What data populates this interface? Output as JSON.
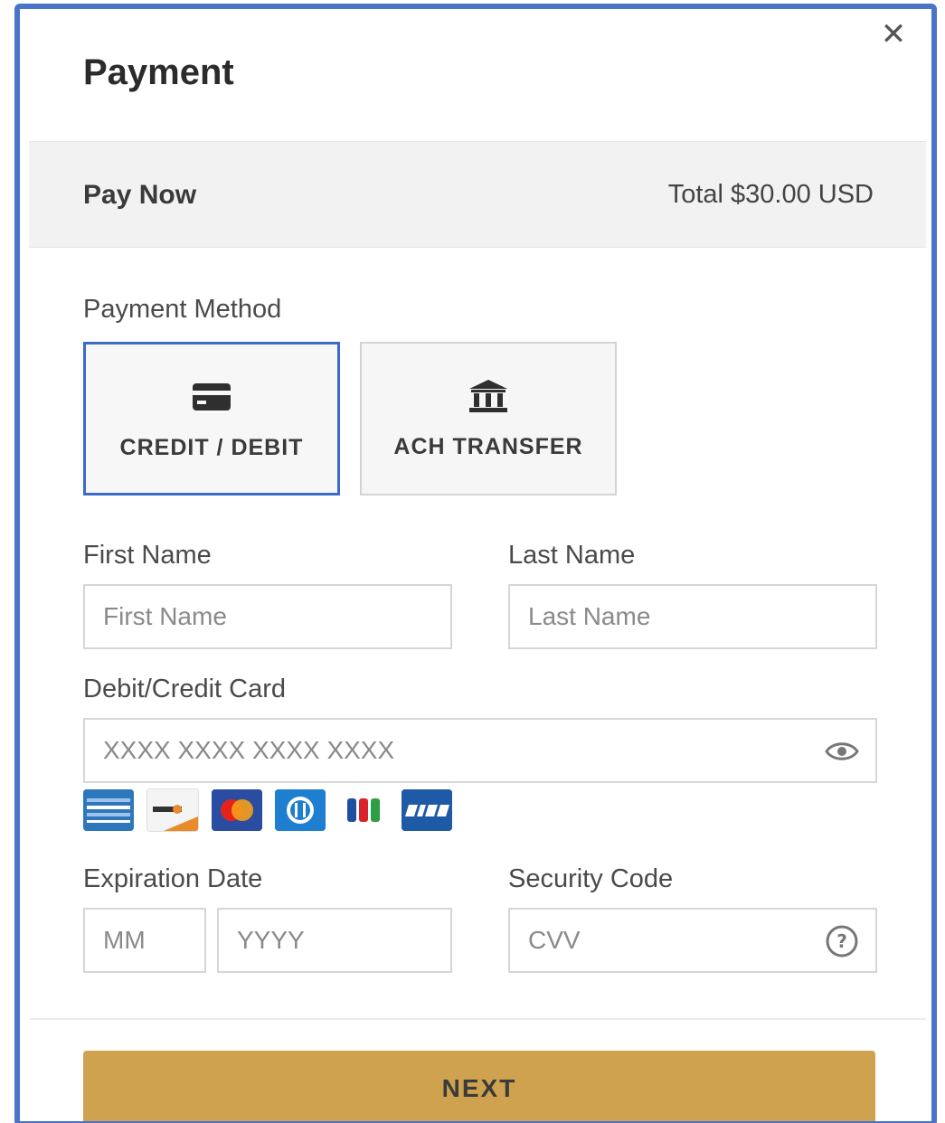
{
  "modal": {
    "title": "Payment",
    "close_icon": "close-icon"
  },
  "summary": {
    "pay_now": "Pay Now",
    "total": "Total $30.00 USD"
  },
  "payment_method": {
    "label": "Payment Method",
    "options": [
      {
        "label": "CREDIT / DEBIT",
        "icon": "credit-card-icon",
        "selected": true
      },
      {
        "label": "ACH TRANSFER",
        "icon": "bank-icon",
        "selected": false
      }
    ]
  },
  "form": {
    "first_name": {
      "label": "First Name",
      "placeholder": "First Name",
      "value": ""
    },
    "last_name": {
      "label": "Last Name",
      "placeholder": "Last Name",
      "value": ""
    },
    "card": {
      "label": "Debit/Credit Card",
      "placeholder": "XXXX XXXX XXXX XXXX",
      "value": "",
      "toggle_icon": "eye-icon"
    },
    "card_brands": [
      "amex",
      "discover",
      "mastercard",
      "diners",
      "jcb",
      "visa"
    ],
    "expiration": {
      "label": "Expiration Date",
      "month_placeholder": "MM",
      "year_placeholder": "YYYY"
    },
    "security": {
      "label": "Security Code",
      "placeholder": "CVV",
      "help_icon": "help-icon"
    }
  },
  "actions": {
    "next_label": "NEXT"
  },
  "colors": {
    "frame_border": "#4a74c9",
    "selected_border": "#3b6bc7",
    "next_button": "#cfa24f",
    "summary_bg": "#f2f2f2"
  }
}
